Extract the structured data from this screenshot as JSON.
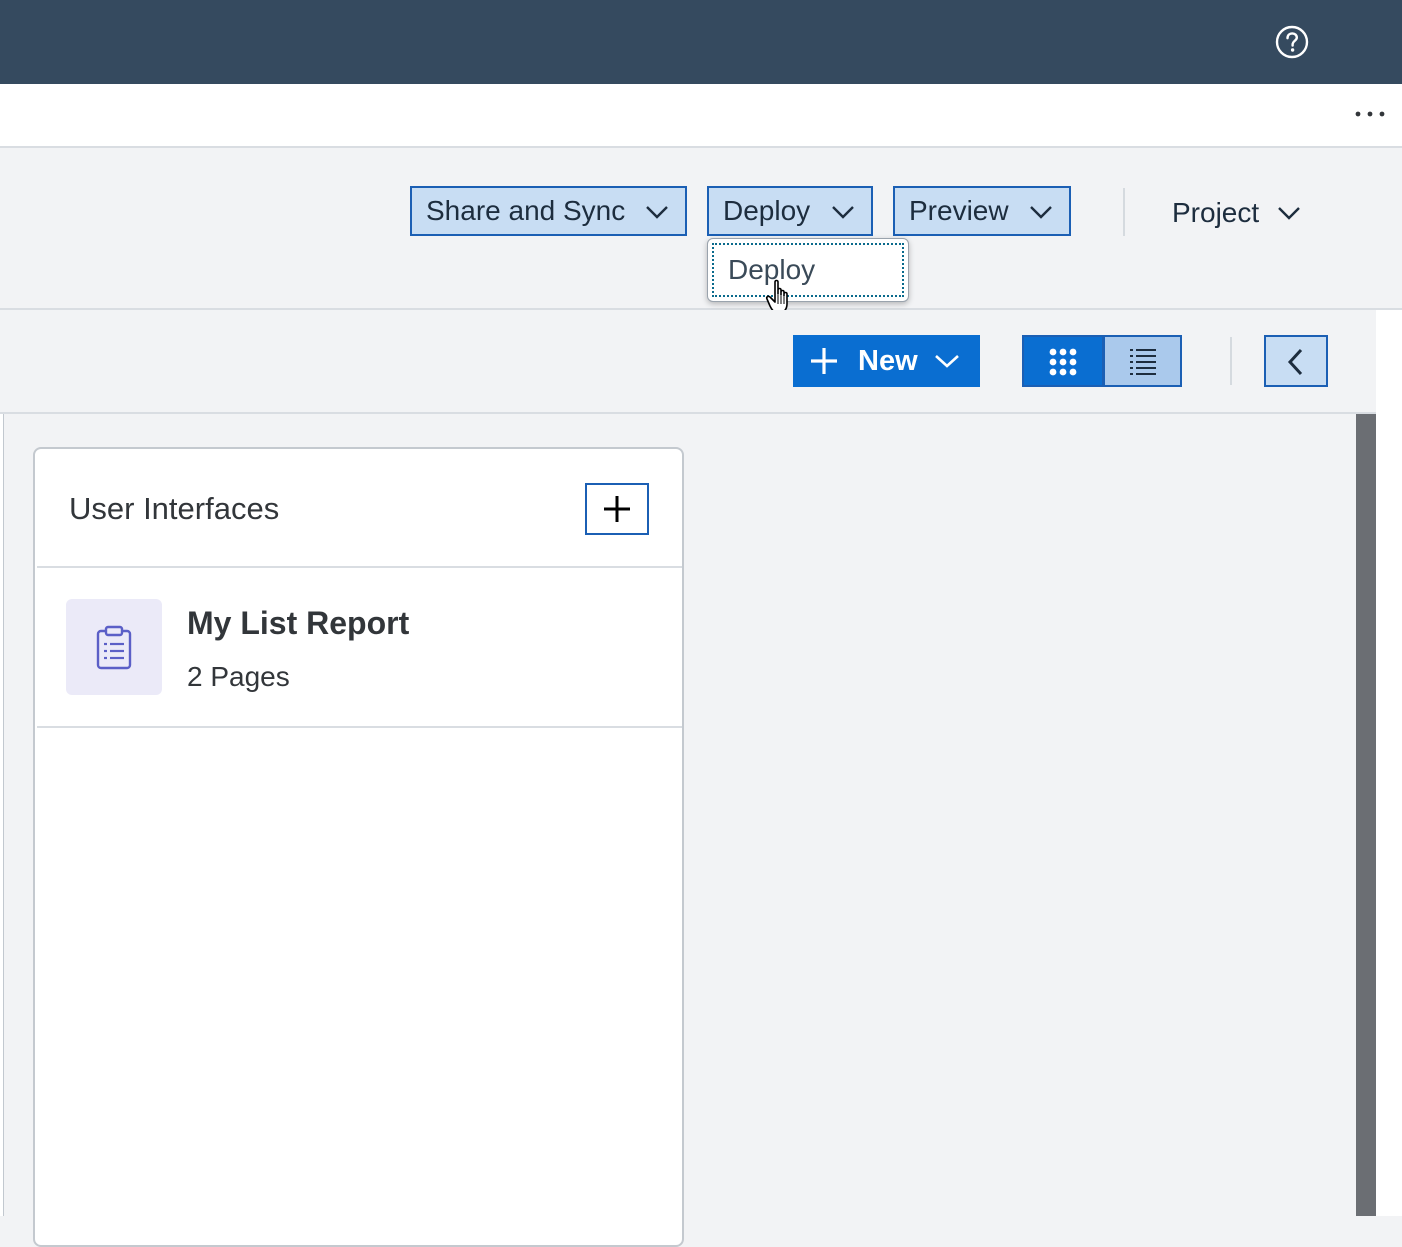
{
  "toolbar": {
    "share_label": "Share and Sync",
    "deploy_label": "Deploy",
    "preview_label": "Preview",
    "project_label": "Project"
  },
  "deploy_menu": {
    "items": [
      {
        "label": "Deploy"
      }
    ]
  },
  "subtoolbar": {
    "new_label": "New",
    "active_view": "grid"
  },
  "card": {
    "title": "User Interfaces",
    "items": [
      {
        "title": "My List Report",
        "subtitle": "2 Pages",
        "icon": "clipboard-list-icon"
      }
    ]
  },
  "icons": {
    "help": "help-icon",
    "more": "more-options-icon",
    "grid": "grid-view-icon",
    "list": "list-view-icon",
    "back": "chevron-left-icon",
    "add": "plus-icon"
  },
  "colors": {
    "header": "#354a5f",
    "accent": "#0a6ed1",
    "button_bg": "#c8ddf3",
    "button_border": "#1b5fb4",
    "icon_tint": "#5b5fc7"
  }
}
